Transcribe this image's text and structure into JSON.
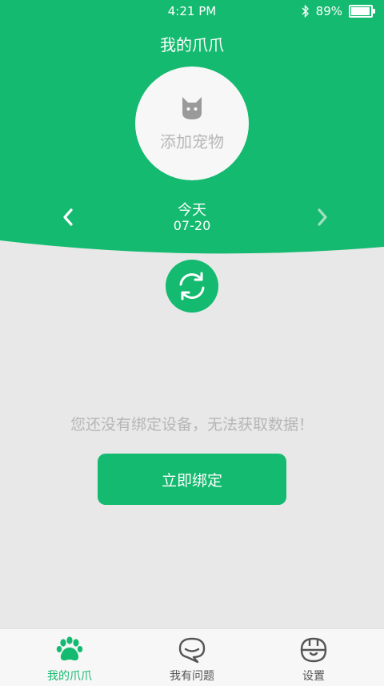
{
  "status_bar": {
    "time": "4:21 PM",
    "battery": "89%",
    "battery_level": 0.89
  },
  "header": {
    "title": "我的爪爪"
  },
  "pet": {
    "add_label": "添加宠物",
    "icon": "cat-icon"
  },
  "date_nav": {
    "today_label": "今天",
    "date": "07-20"
  },
  "main": {
    "notice": "您还没有绑定设备，无法获取数据！",
    "bind_button": "立即绑定"
  },
  "tabs": [
    {
      "label": "我的爪爪",
      "icon": "paw-icon",
      "active": true
    },
    {
      "label": "我有问题",
      "icon": "chat-bubble-icon",
      "active": false
    },
    {
      "label": "设置",
      "icon": "settings-icon",
      "active": false
    }
  ],
  "colors": {
    "accent": "#14ba6f",
    "background": "#e8e8e8",
    "muted_text": "#b6b6b6"
  }
}
